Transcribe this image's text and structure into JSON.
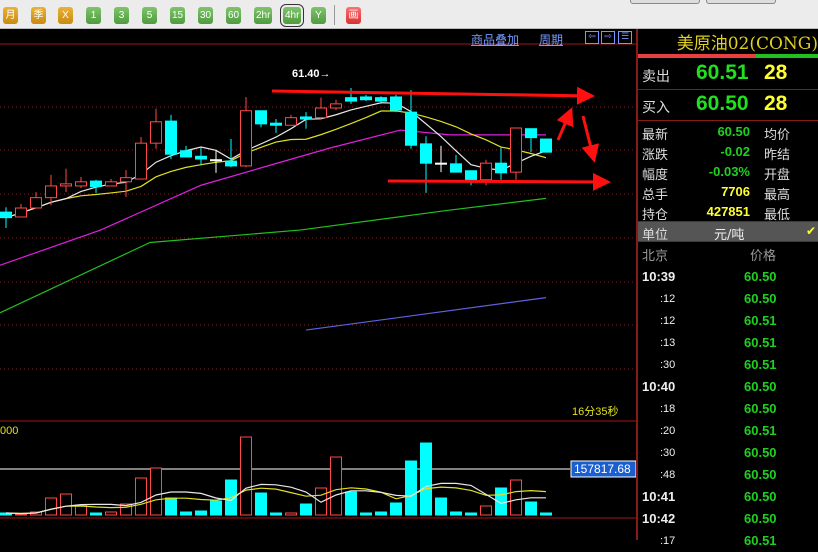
{
  "toolbar": {
    "buttons": [
      {
        "label": "月",
        "style": "y"
      },
      {
        "label": "季",
        "style": "y"
      },
      {
        "label": "X",
        "style": "y"
      },
      {
        "label": "1",
        "style": "g"
      },
      {
        "label": "3",
        "style": "g"
      },
      {
        "label": "5",
        "style": "g"
      },
      {
        "label": "15",
        "style": "g"
      },
      {
        "label": "30",
        "style": "g"
      },
      {
        "label": "60",
        "style": "g"
      },
      {
        "label": "2hr",
        "style": "g"
      },
      {
        "label": "4hr",
        "style": "g",
        "selected": true
      },
      {
        "label": "Y",
        "style": "g"
      },
      {
        "label": "画",
        "style": "r"
      }
    ]
  },
  "chart_header": {
    "overlay_link": "商品叠加",
    "period_link": "周期"
  },
  "chart": {
    "high_label": "61.40→",
    "timer": "16分35秒",
    "volume_axis_label": "000",
    "volume_ref_label": "157817.68",
    "volume_ref_value": 157817.68,
    "price_high": 61.4,
    "colors": {
      "up": "#ff4848",
      "down": "#00ffff",
      "ma5": "#e8e8e8",
      "ma10": "#e0e020",
      "ma20": "#e020e0",
      "ma60": "#20c020",
      "ma120": "#6060e0",
      "annotation": "#ff1010"
    },
    "candles": [
      [
        59.6,
        59.67,
        59.37,
        59.52
      ],
      [
        59.53,
        59.72,
        59.53,
        59.66
      ],
      [
        59.66,
        59.89,
        59.66,
        59.81
      ],
      [
        59.81,
        60.14,
        59.7,
        59.98
      ],
      [
        59.98,
        60.23,
        59.89,
        60.01
      ],
      [
        59.98,
        60.11,
        59.95,
        60.04
      ],
      [
        60.05,
        60.07,
        59.88,
        59.97
      ],
      [
        59.98,
        60.08,
        59.98,
        60.04
      ],
      [
        60.04,
        60.21,
        59.82,
        60.1
      ],
      [
        60.08,
        60.69,
        60.08,
        60.6
      ],
      [
        60.6,
        61.1,
        60.52,
        60.91
      ],
      [
        60.92,
        61.01,
        60.37,
        60.44
      ],
      [
        60.49,
        60.56,
        60.4,
        60.4
      ],
      [
        60.41,
        60.54,
        60.28,
        60.37
      ],
      [
        60.36,
        60.49,
        60.17,
        60.36
      ],
      [
        60.34,
        60.66,
        60.25,
        60.27
      ],
      [
        60.27,
        61.27,
        60.25,
        61.07
      ],
      [
        61.07,
        61.07,
        60.83,
        60.88
      ],
      [
        60.89,
        60.95,
        60.75,
        60.86
      ],
      [
        60.86,
        61.01,
        60.86,
        60.97
      ],
      [
        60.98,
        61.05,
        60.81,
        60.95
      ],
      [
        60.97,
        61.26,
        60.95,
        61.11
      ],
      [
        61.11,
        61.23,
        61.08,
        61.17
      ],
      [
        61.26,
        61.4,
        61.17,
        61.21
      ],
      [
        61.27,
        61.3,
        61.21,
        61.23
      ],
      [
        61.26,
        61.28,
        61.17,
        61.21
      ],
      [
        61.27,
        61.3,
        61.05,
        61.08
      ],
      [
        61.05,
        61.37,
        60.52,
        60.57
      ],
      [
        60.59,
        60.7,
        59.88,
        60.31
      ],
      [
        60.31,
        60.56,
        60.18,
        60.31
      ],
      [
        60.3,
        60.43,
        60.18,
        60.18
      ],
      [
        60.2,
        60.2,
        59.99,
        60.07
      ],
      [
        60.07,
        60.36,
        59.99,
        60.31
      ],
      [
        60.31,
        60.54,
        60.07,
        60.17
      ],
      [
        60.18,
        60.82,
        60.07,
        60.82
      ],
      [
        60.81,
        60.81,
        60.47,
        60.68
      ],
      [
        60.66,
        60.66,
        60.47,
        60.47
      ]
    ],
    "ma20": [
      [
        -0.4,
        58.83
      ],
      [
        6.3,
        59.34
      ],
      [
        13,
        59.99
      ],
      [
        17.6,
        60.28
      ],
      [
        21.6,
        60.53
      ],
      [
        26.3,
        60.79
      ],
      [
        29.6,
        60.72
      ],
      [
        36,
        60.72
      ]
    ],
    "ma60": [
      [
        -0.4,
        58.14
      ],
      [
        9.6,
        59.16
      ],
      [
        19.6,
        59.34
      ],
      [
        29.6,
        59.63
      ],
      [
        36,
        59.8
      ]
    ],
    "ma120": [
      [
        20,
        57.89
      ],
      [
        36,
        58.36
      ]
    ],
    "volumes": [
      6900,
      3400,
      10300,
      58300,
      72000,
      34300,
      6900,
      10300,
      37700,
      126900,
      161200,
      58300,
      10300,
      13700,
      48000,
      120000,
      267500,
      75400,
      6900,
      6900,
      37700,
      92600,
      198900,
      78900,
      6900,
      10300,
      41200,
      185200,
      246900,
      58300,
      10300,
      6900,
      30900,
      92600,
      120000,
      44600,
      6900
    ]
  },
  "quote": {
    "title": "美原油02(CONG)",
    "ask": {
      "label": "卖出",
      "price": "60.51",
      "volume": "28"
    },
    "bid": {
      "label": "买入",
      "price": "60.50",
      "volume": "28"
    },
    "rows": [
      {
        "label": "最新",
        "value": "60.50",
        "color": "#20d020",
        "label2": "均价"
      },
      {
        "label": "涨跌",
        "value": "-0.02",
        "color": "#20d020",
        "label2": "昨结"
      },
      {
        "label": "幅度",
        "value": "-0.03%",
        "color": "#20d020",
        "label2": "开盘"
      },
      {
        "label": "总手",
        "value": "7706",
        "color": "#ffff30",
        "label2": "最高"
      },
      {
        "label": "持仓",
        "value": "427851",
        "color": "#ffff30",
        "label2": "最低"
      }
    ],
    "unit_label": "单位",
    "unit_value": "元/吨",
    "unit_check": "✔"
  },
  "ticks": {
    "head_time": "北京",
    "head_price": "价格",
    "rows": [
      {
        "time": "10:39",
        "price": "60.50",
        "big": true
      },
      {
        "time": ":12",
        "price": "60.50"
      },
      {
        "time": ":12",
        "price": "60.51"
      },
      {
        "time": ":13",
        "price": "60.51"
      },
      {
        "time": ":30",
        "price": "60.51"
      },
      {
        "time": "10:40",
        "price": "60.50",
        "big": true
      },
      {
        "time": ":18",
        "price": "60.50"
      },
      {
        "time": ":20",
        "price": "60.51"
      },
      {
        "time": ":30",
        "price": "60.50"
      },
      {
        "time": ":48",
        "price": "60.50"
      },
      {
        "time": "10:41",
        "price": "60.50",
        "big": true
      },
      {
        "time": "10:42",
        "price": "60.50",
        "big": true
      },
      {
        "time": ":17",
        "price": "60.51"
      }
    ]
  }
}
